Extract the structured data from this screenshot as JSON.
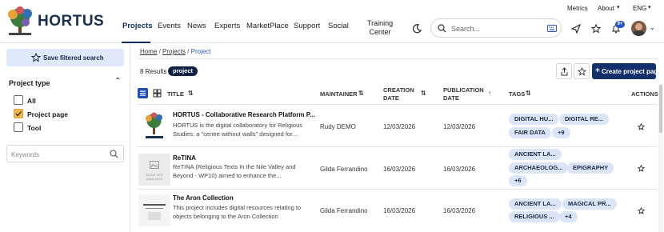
{
  "utility": {
    "metrics": "Metrics",
    "about": "About",
    "lang": "ENG"
  },
  "brand": {
    "name": "HORTUS"
  },
  "nav": [
    "Projects",
    "Events",
    "News",
    "Experts",
    "MarketPlace",
    "Support",
    "Social",
    "Training",
    "Center"
  ],
  "search": {
    "placeholder": "Search..."
  },
  "notifications": {
    "count": "9+"
  },
  "sidebar": {
    "save_label": "Save filtered search",
    "section": "Project type",
    "options": [
      "All",
      "Project page",
      "Tool"
    ],
    "keywords_placeholder": "Keywords"
  },
  "breadcrumb": {
    "home": "Home",
    "projects": "Projects",
    "current": "Project"
  },
  "results": {
    "text": "8 Results",
    "filter": "project"
  },
  "create_label": "Create project page",
  "columns": {
    "title": "TITLE",
    "maintainer": "MAINTAINER",
    "creation_1": "CREATION",
    "creation_2": "DATE",
    "publication_1": "PUBLICATION",
    "publication_2": "DATE",
    "tags": "TAGS",
    "actions": "ACTIONS"
  },
  "rows": [
    {
      "title": "HORTUS - Collaborative Research Platform P...",
      "desc_1": "HORTUS is the digital collaboratory for Religious",
      "desc_2": "Studies: a \"centre without walls\" designed for...",
      "desc_3": "",
      "maintainer": "Rudy DEMO",
      "created": "12/03/2026",
      "published": "12/03/2026",
      "tags": [
        "DIGITAL HU...",
        "DIGITAL RE...",
        "FAIR DATA",
        "+9"
      ]
    },
    {
      "title": "ReTINA",
      "desc_1": "ReTINA (Religious Texts In the Nile Valley and",
      "desc_2": "Beyond - WP10) aimed to enhance the...",
      "desc_3": "",
      "maintainer": "Gilda Ferrandino",
      "created": "16/03/2026",
      "published": "16/03/2026",
      "tags": [
        "ANCIENT LA...",
        "ARCHAEOLOG...",
        "EPIGRAPHY",
        "+6"
      ],
      "no_image_1": "IMAGE NOT",
      "no_image_2": "AVAILABLE"
    },
    {
      "title": "The Aron Collection",
      "desc_1": "This project includes digital resources relating to",
      "desc_2": "objects belonging to the Aron Collection",
      "desc_3": "",
      "maintainer": "Gilda Ferrandino",
      "created": "16/03/2026",
      "published": "16/03/2026",
      "tags": [
        "ANCIENT LA...",
        "MAGICAL PR...",
        "RELIGIOUS ...",
        "+4"
      ]
    }
  ],
  "colors": {
    "navy": "#0d2c5b",
    "accent": "#14306a",
    "tag_bg": "#dbe5f7",
    "check": "#f2b84b"
  }
}
